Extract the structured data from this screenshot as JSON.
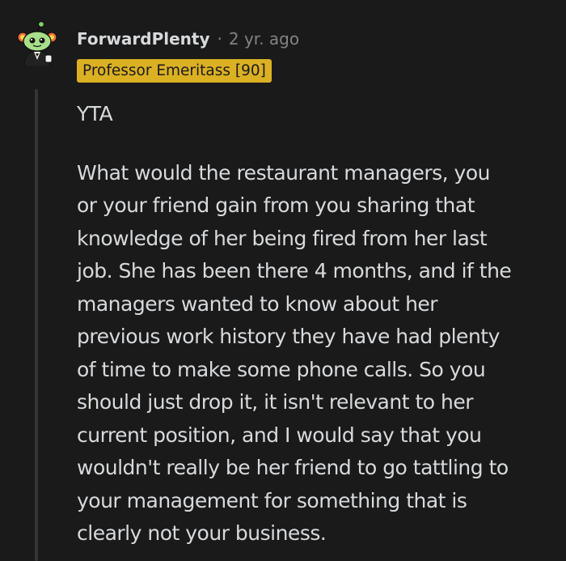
{
  "comment": {
    "username": "ForwardPlenty",
    "separator": "·",
    "age": "2 yr. ago",
    "flair": "Professor Emeritass [90]",
    "verdict": "YTA",
    "paragraph_lines": [
      "What would the restaurant managers, you",
      "or your friend gain from you sharing that",
      "knowledge of her being fired from her last",
      "job. She has been there 4 months, and if the",
      "managers wanted to know about her",
      "previous work history they have had plenty",
      "of time to make some phone calls. So you",
      "should just drop it, it isn't relevant to her",
      "current position, and I would say that you",
      "wouldn't really be her friend to go tattling to",
      "your management for something that is",
      "clearly not your business."
    ]
  },
  "colors": {
    "background": "#1a1a1b",
    "text": "#d7dadc",
    "muted": "#818384",
    "flair_bg": "#dbb123",
    "thread_line": "#343536"
  },
  "icons": {
    "avatar": "snoo-avatar-icon"
  }
}
